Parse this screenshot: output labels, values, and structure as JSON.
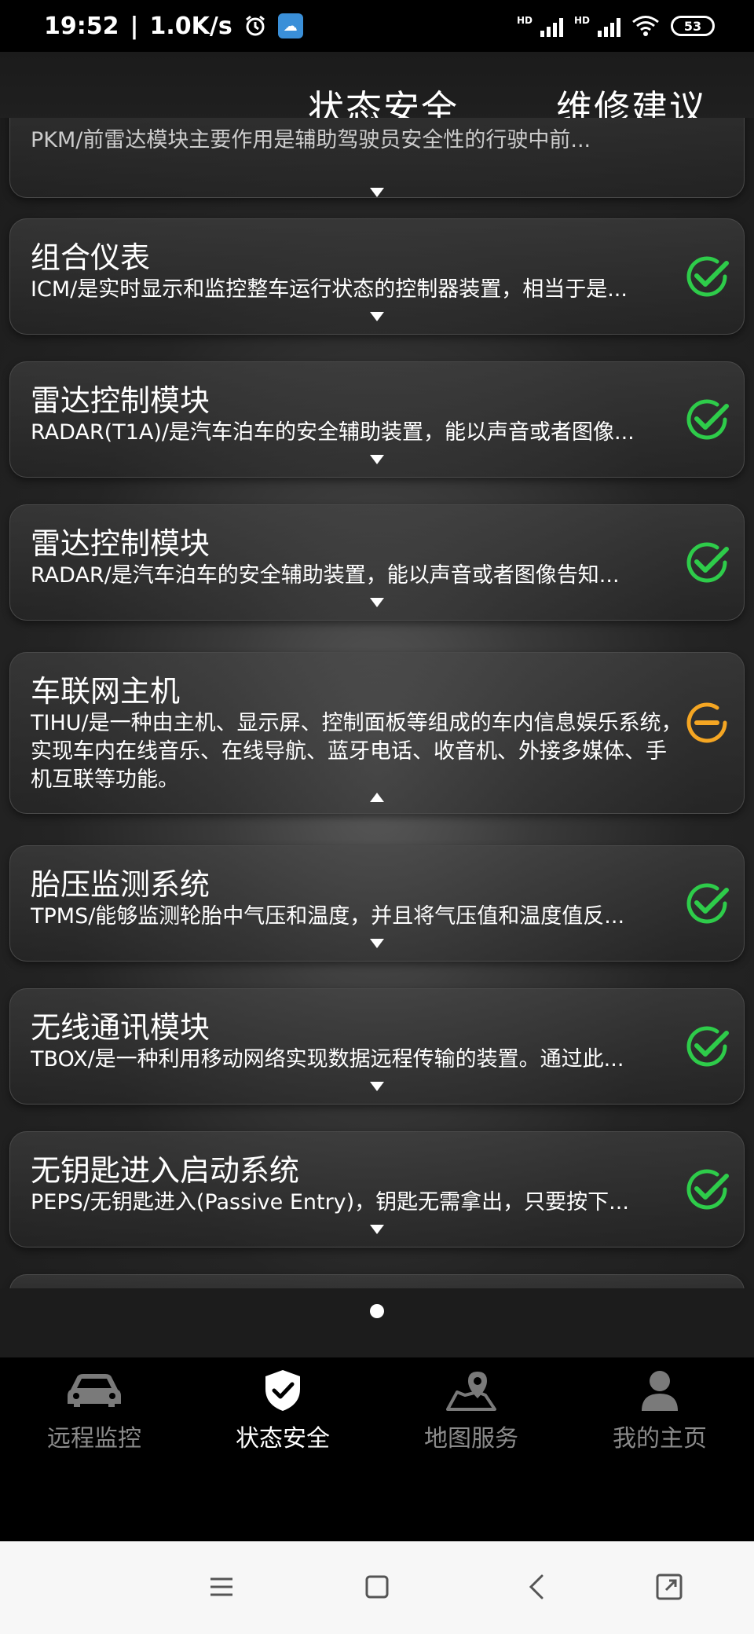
{
  "status_bar": {
    "time": "19:52",
    "speed": "1.0K/s",
    "signal_label_1": "HD",
    "signal_label_2": "HD",
    "battery": "53"
  },
  "header": {
    "tab_1": "状态安全",
    "tab_2": "维修建议"
  },
  "cards": [
    {
      "title": "",
      "desc": "PKM/前雷达模块主要作用是辅助驾驶员安全性的行驶中前...",
      "status": "ok",
      "expanded": false
    },
    {
      "title": "组合仪表",
      "desc": "ICM/是实时显示和监控整车运行状态的控制器装置，相当于是...",
      "status": "ok",
      "expanded": false
    },
    {
      "title": "雷达控制模块",
      "desc": "RADAR(T1A)/是汽车泊车的安全辅助装置，能以声音或者图像...",
      "status": "ok",
      "expanded": false
    },
    {
      "title": "雷达控制模块",
      "desc": "RADAR/是汽车泊车的安全辅助装置，能以声音或者图像告知...",
      "status": "ok",
      "expanded": false
    },
    {
      "title": "车联网主机",
      "desc": "TIHU/是一种由主机、显示屏、控制面板等组成的车内信息娱乐系统，实现车内在线音乐、在线导航、蓝牙电话、收音机、外接多媒体、手机互联等功能。",
      "status": "warning",
      "expanded": true
    },
    {
      "title": "胎压监测系统",
      "desc": "TPMS/能够监测轮胎中气压和温度，并且将气压值和温度值反...",
      "status": "ok",
      "expanded": false
    },
    {
      "title": "无线通讯模块",
      "desc": "TBOX/是一种利用移动网络实现数据远程传输的装置。通过此...",
      "status": "ok",
      "expanded": false
    },
    {
      "title": "无钥匙进入启动系统",
      "desc": "PEPS/无钥匙进入(Passive Entry)，钥匙无需拿出，只要按下...",
      "status": "ok",
      "expanded": false
    }
  ],
  "colors": {
    "ok": "#2ecc4a",
    "warning": "#f5a623"
  },
  "bottom_nav": [
    {
      "label": "远程监控",
      "icon": "car-icon",
      "active": false
    },
    {
      "label": "状态安全",
      "icon": "shield-check-icon",
      "active": true
    },
    {
      "label": "地图服务",
      "icon": "map-pin-icon",
      "active": false
    },
    {
      "label": "我的主页",
      "icon": "person-icon",
      "active": false
    }
  ],
  "system_nav": [
    "menu-icon",
    "home-icon",
    "back-icon",
    "screenshot-icon"
  ]
}
